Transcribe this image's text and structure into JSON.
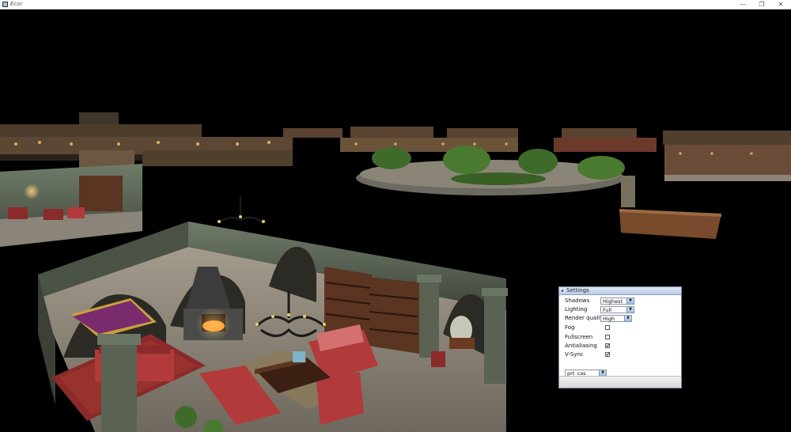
{
  "window": {
    "title": "Ecor",
    "minimize_glyph": "—",
    "restore_glyph": "❐",
    "close_glyph": "✕"
  },
  "settings": {
    "title": "Settings",
    "collapse_glyph": "◂",
    "shadows": {
      "label": "Shadows",
      "value": "Highest"
    },
    "lighting": {
      "label": "Lighting",
      "value": "Full"
    },
    "render_quality": {
      "label": "Render quality",
      "value": "High"
    },
    "fog": {
      "label": "Fog",
      "checked": false
    },
    "fullscreen": {
      "label": "Fullscreen",
      "checked": false
    },
    "antialiasing": {
      "label": "Antialiasing",
      "checked": true
    },
    "vsync": {
      "label": "V-Sync",
      "checked": true
    },
    "scene": {
      "value": "prt_cas"
    },
    "check_glyph": "✔",
    "arrow_glyph": "▼"
  },
  "colors": {
    "floor": "#8c857a",
    "wall": "#5d6a5c",
    "rug": "#8b2a2a",
    "sofa": "#b23a3a",
    "wood": "#6b3a20",
    "gold": "#c9a03a",
    "foliage": "#3f6b2a",
    "light": "#f3c96a"
  }
}
